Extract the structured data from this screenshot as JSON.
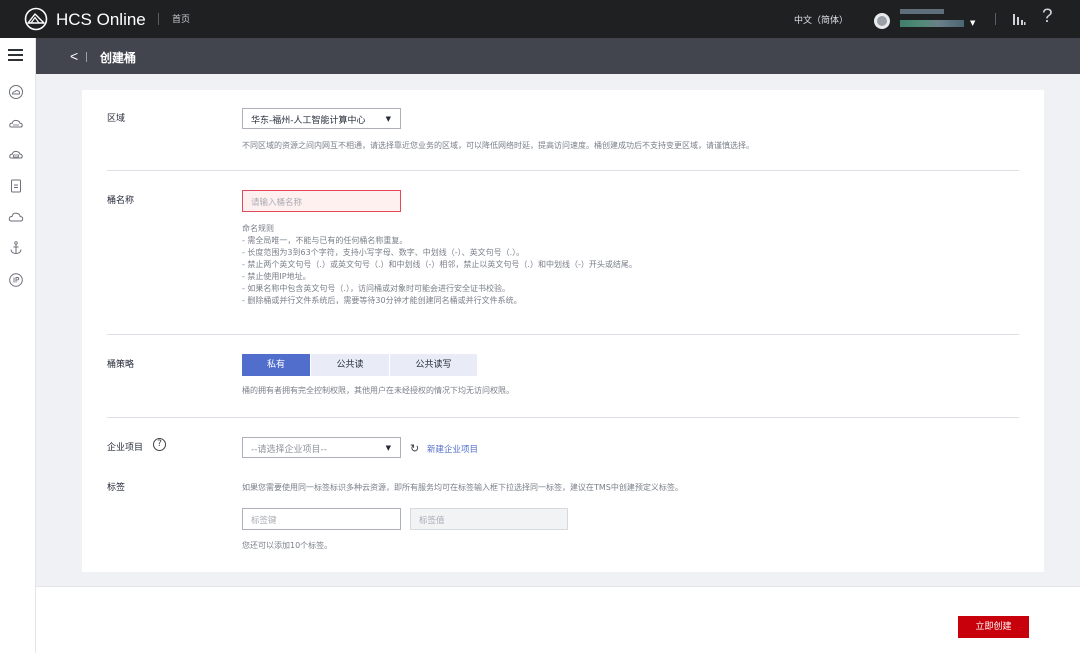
{
  "header": {
    "brand": "HCS Online",
    "home_link": "首页",
    "language": "中文（简体）",
    "help_glyph": "?"
  },
  "title_bar": {
    "back_glyph": "<",
    "title": "创建桶"
  },
  "sidebar": {
    "icons": [
      "menu-icon",
      "cloud-icon",
      "cloud-dots-icon",
      "cloud-database-icon",
      "document-icon",
      "cloud-outline-icon",
      "anchor-icon",
      "ip-icon"
    ]
  },
  "form": {
    "region": {
      "label": "区域",
      "value": "华东-福州-人工智能计算中心",
      "hint": "不同区域的资源之间内网互不相通，请选择靠近您业务的区域，可以降低网络时延，提高访问速度。桶创建成功后不支持变更区域，请谨慎选择。"
    },
    "bucket_name": {
      "label": "桶名称",
      "placeholder": "请输入桶名称",
      "rules": [
        "命名规则",
        "- 需全局唯一，不能与已有的任何桶名称重复。",
        "- 长度范围为3到63个字符，支持小写字母、数字、中划线（-）、英文句号（.）。",
        "- 禁止两个英文句号（.）或英文句号（.）和中划线（-）相邻，禁止以英文句号（.）和中划线（-）开头或结尾。",
        "- 禁止使用IP地址。",
        "- 如果名称中包含英文句号（.），访问桶或对象时可能会进行安全证书校验。",
        "- 删除桶或并行文件系统后，需要等待30分钟才能创建同名桶或并行文件系统。"
      ]
    },
    "policy": {
      "label": "桶策略",
      "options": [
        "私有",
        "公共读",
        "公共读写"
      ],
      "selected": "私有",
      "hint": "桶的拥有者拥有完全控制权限，其他用户在未经授权的情况下均无访问权限。"
    },
    "enterprise_project": {
      "label": "企业项目",
      "help_glyph": "?",
      "value": "--请选择企业项目--",
      "new_link": "新建企业项目"
    },
    "tags": {
      "label": "标签",
      "hint": "如果您需要使用同一标签标识多种云资源，即所有服务均可在标签输入框下拉选择同一标签，建议在TMS中创建预定义标签。",
      "key_placeholder": "标签键",
      "value_placeholder": "标签值",
      "remaining": "您还可以添加10个标签。"
    }
  },
  "footer": {
    "create_button": "立即创建"
  },
  "colors": {
    "topbar": "#1f2022",
    "titlebar": "#42454e",
    "primary": "#526ecc",
    "danger": "#c7000b",
    "error_border": "#e3495b"
  }
}
